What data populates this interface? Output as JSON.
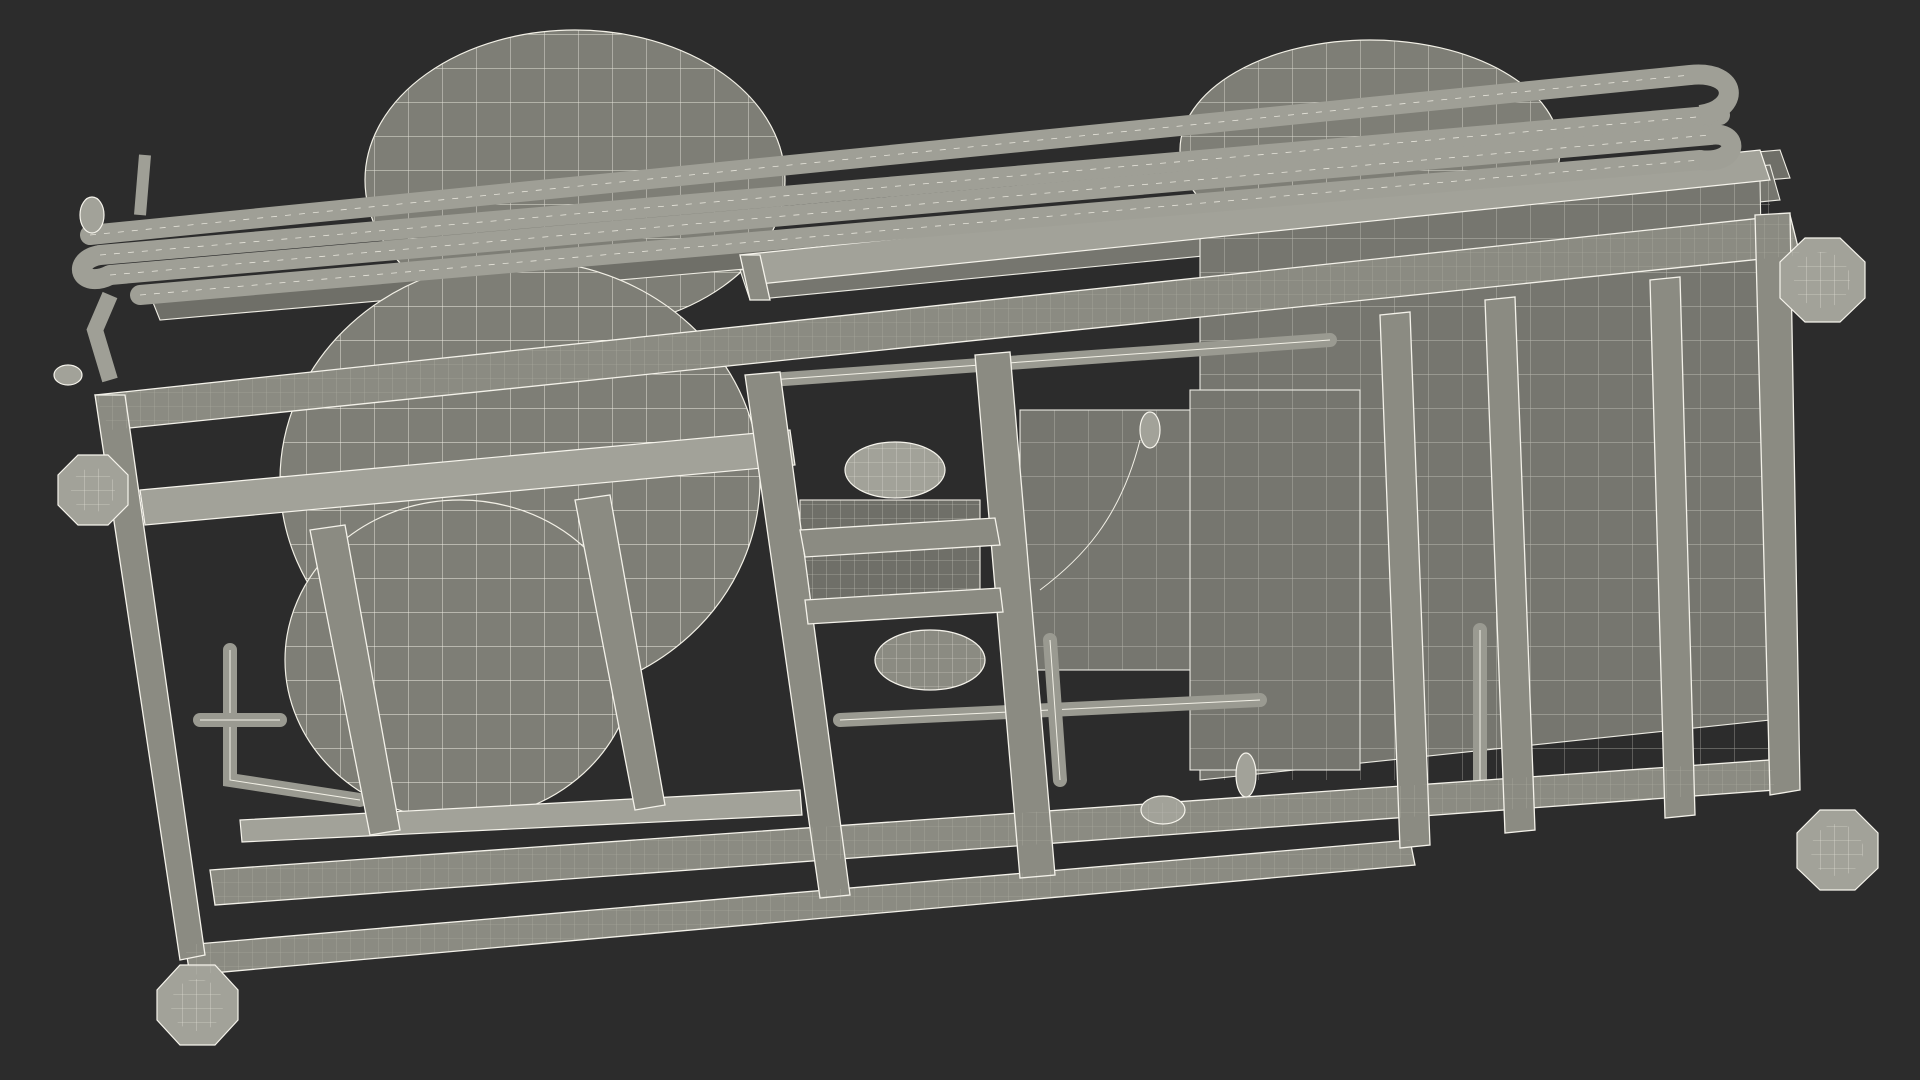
{
  "scene": {
    "subject_icon": "frame-unit-wireframe-icon",
    "background_color": "#2c2c2c",
    "wire_color": "#f2f0e6",
    "surface_color": "#8b8b82"
  }
}
